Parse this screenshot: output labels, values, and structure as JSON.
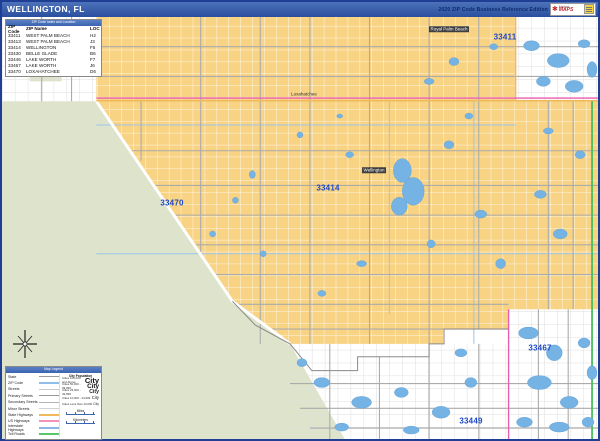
{
  "header": {
    "title": "WELLINGTON, FL",
    "edition": "2020 ZIP Code Business Reference Edition",
    "logo": {
      "market": "Market",
      "maps": "MAPS"
    }
  },
  "zip_table": {
    "title": "ZIP Code Index and Location",
    "columns": [
      "ZIP Code",
      "ZIP Name",
      "LOC"
    ],
    "rows": [
      {
        "zip": "33411",
        "name": "WEST PALM BEACH",
        "loc": "H2"
      },
      {
        "zip": "33413",
        "name": "WEST PALM BEACH",
        "loc": "J3"
      },
      {
        "zip": "33414",
        "name": "WELLINGTON",
        "loc": "F5"
      },
      {
        "zip": "33430",
        "name": "BELLE GLADE",
        "loc": "B6"
      },
      {
        "zip": "33446",
        "name": "LAKE WORTH",
        "loc": "F7"
      },
      {
        "zip": "33467",
        "name": "LAKE WORTH",
        "loc": "J6"
      },
      {
        "zip": "33470",
        "name": "LOXAHATCHEE",
        "loc": "D6"
      }
    ]
  },
  "map": {
    "zip_labels": [
      {
        "text": "33411"
      },
      {
        "text": "33414"
      },
      {
        "text": "33470"
      },
      {
        "text": "33467"
      },
      {
        "text": "33449"
      }
    ],
    "city_labels": [
      {
        "text": "Royal Palm Beach"
      },
      {
        "text": "Loxahatchee"
      },
      {
        "text": "Wellington"
      }
    ],
    "colors": {
      "zip_area_fill": "#F8D383",
      "parkland_fill": "#DDE4CB",
      "water": "#74B3E4",
      "zip_boundary": "#E85FB0",
      "toll_road": "#45C058",
      "state_highway": "#F0B95C",
      "zip_label_text": "#1B49C8"
    }
  },
  "legend": {
    "title": "Map Legend",
    "road_items": [
      {
        "label": "State",
        "color": "#9a9a9a",
        "thickness": 1
      },
      {
        "label": "ZIP Code",
        "color": "#8FBCE8",
        "thickness": 2
      },
      {
        "label": "Streets",
        "color": "#c9c9c9",
        "thickness": 1
      },
      {
        "label": "Primary Streets",
        "color": "#9a9a9a",
        "thickness": 1
      },
      {
        "label": "Secondary Streets",
        "color": "#b4b4b4",
        "thickness": 1
      },
      {
        "label": "Minor Streets",
        "color": "#d2d2d2",
        "thickness": 1
      },
      {
        "label": "State Highways",
        "color": "#F0B95C",
        "thickness": 2
      },
      {
        "label": "US Highways",
        "color": "#F293BE",
        "thickness": 2
      },
      {
        "label": "Interstate Highways",
        "color": "#8FB4E6",
        "thickness": 2
      },
      {
        "label": "Toll Roads",
        "color": "#5BC56A",
        "thickness": 2
      }
    ],
    "city_population": {
      "title": "City Population",
      "items": [
        {
          "label": "Cities 100,000 and Above",
          "sample": "City"
        },
        {
          "label": "Cities 50,000 - 99,999",
          "sample": "City"
        },
        {
          "label": "Cities 25,000 - 49,999",
          "sample": "City"
        },
        {
          "label": "Cities 10,000 - 24,999",
          "sample": "City"
        },
        {
          "label": "Cities Less than 10,000",
          "sample": "City"
        }
      ]
    },
    "scales": {
      "miles": "Miles",
      "kilometers": "Kilometers"
    }
  }
}
